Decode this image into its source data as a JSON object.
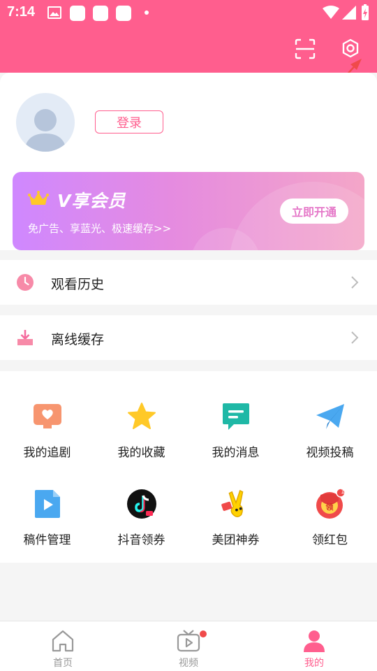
{
  "status_bar": {
    "time": "7:14"
  },
  "header": {
    "scan_icon": "scan-icon",
    "settings_icon": "gear-icon"
  },
  "profile": {
    "login_label": "登录"
  },
  "vip": {
    "title": "V享会员",
    "subtitle": "免广告、享蓝光、极速缓存>>",
    "button": "立即开通"
  },
  "menu": {
    "history": "观看历史",
    "offline": "离线缓存"
  },
  "grid": [
    {
      "label": "我的追剧",
      "icon": "tv-heart-icon"
    },
    {
      "label": "我的收藏",
      "icon": "star-icon"
    },
    {
      "label": "我的消息",
      "icon": "message-icon"
    },
    {
      "label": "视频投稿",
      "icon": "paper-plane-icon"
    },
    {
      "label": "稿件管理",
      "icon": "video-file-icon"
    },
    {
      "label": "抖音领券",
      "icon": "douyin-icon"
    },
    {
      "label": "美团神券",
      "icon": "meituan-icon"
    },
    {
      "label": "领红包",
      "icon": "red-envelope-icon"
    }
  ],
  "tabbar": [
    {
      "label": "首页",
      "icon": "home-icon"
    },
    {
      "label": "视频",
      "icon": "tv-play-icon"
    },
    {
      "label": "我的",
      "icon": "person-icon"
    }
  ],
  "colors": {
    "accent": "#ff5e8e",
    "vip_start": "#cf88ff",
    "vip_end": "#f4a6c8"
  },
  "badge": {
    "red_envelope_count": "1"
  }
}
